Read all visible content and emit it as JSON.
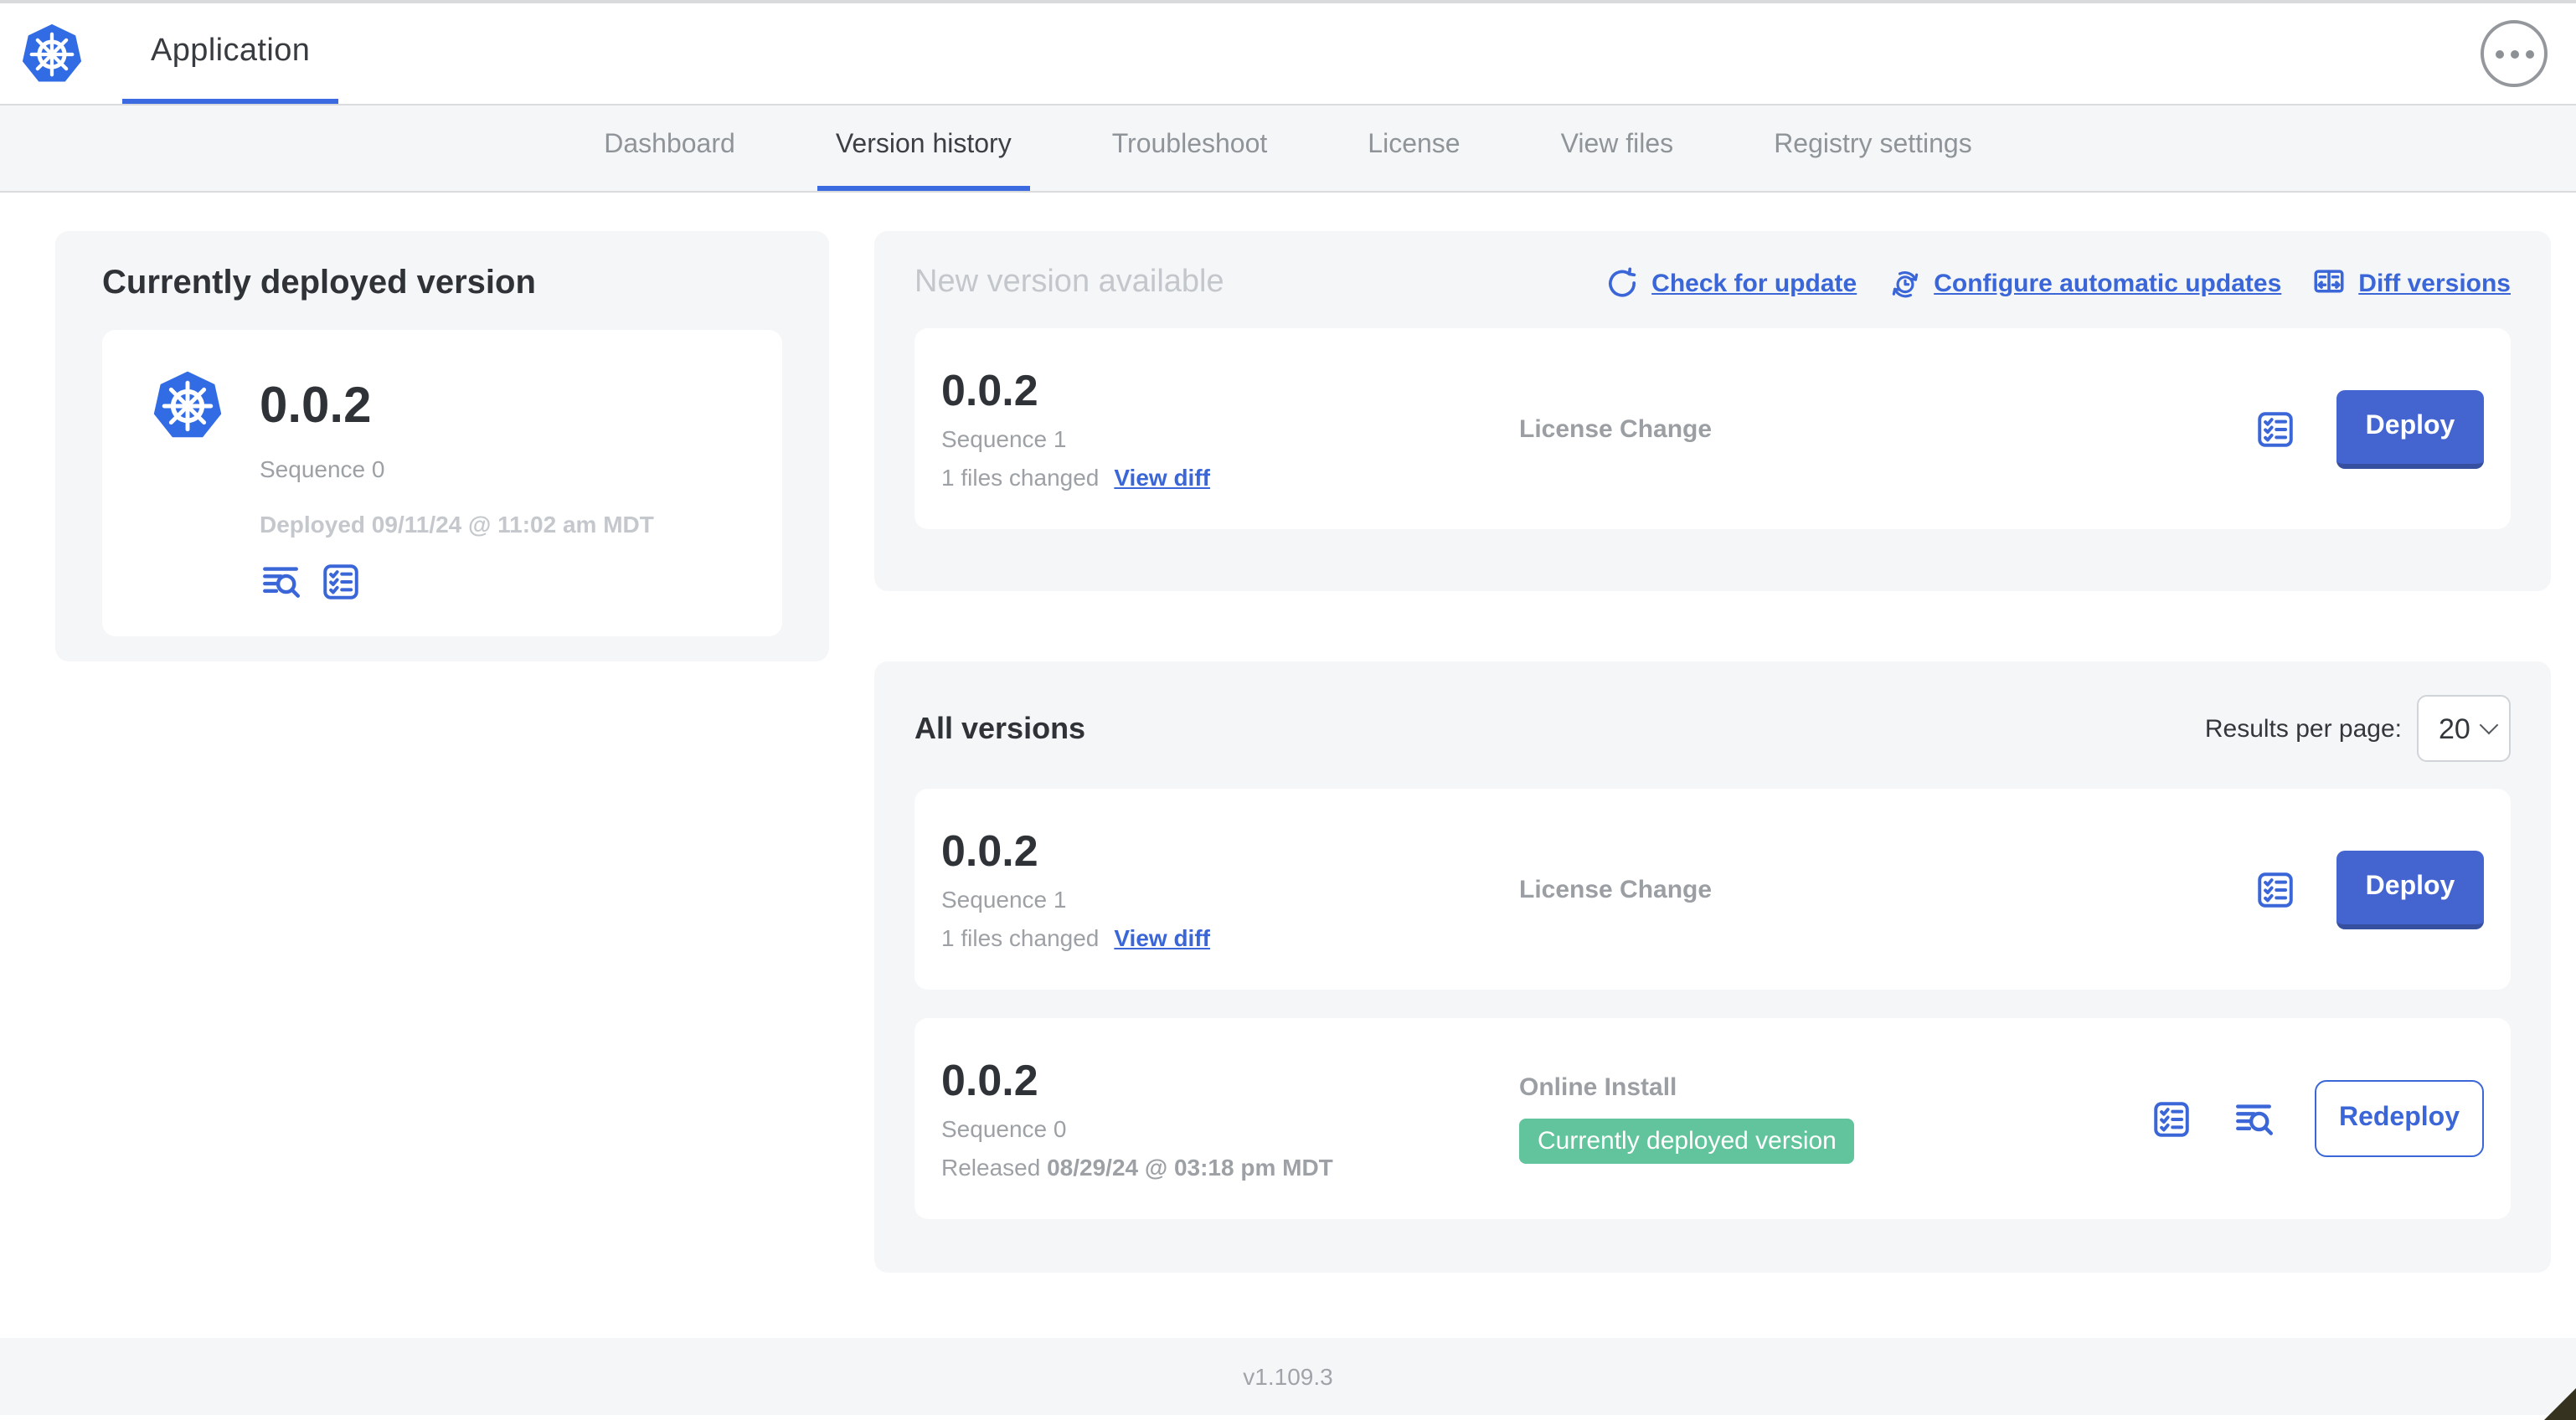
{
  "header": {
    "app_title": "Application"
  },
  "nav": {
    "tabs": [
      {
        "label": "Dashboard"
      },
      {
        "label": "Version history"
      },
      {
        "label": "Troubleshoot"
      },
      {
        "label": "License"
      },
      {
        "label": "View files"
      },
      {
        "label": "Registry settings"
      }
    ],
    "active_tab": "Version history"
  },
  "current_version_panel": {
    "title": "Currently deployed version",
    "version": "0.0.2",
    "sequence": "Sequence 0",
    "deployed": "Deployed 09/11/24 @ 11:02 am MDT"
  },
  "new_version_panel": {
    "title": "New version available",
    "actions": {
      "check_for_update": "Check for update",
      "configure_automatic_updates": "Configure automatic updates",
      "diff_versions": "Diff versions"
    },
    "card": {
      "version": "0.0.2",
      "sequence": "Sequence 1",
      "files_changed": "1 files changed",
      "view_diff": "View diff",
      "source": "License Change",
      "deploy_label": "Deploy"
    }
  },
  "all_versions_panel": {
    "title": "All versions",
    "results_per_page_label": "Results per page:",
    "results_per_page_value": "20",
    "rows": [
      {
        "version": "0.0.2",
        "sequence": "Sequence 1",
        "files_changed": "1 files changed",
        "view_diff": "View diff",
        "source": "License Change",
        "action_label": "Deploy"
      },
      {
        "version": "0.0.2",
        "sequence": "Sequence 0",
        "released_label": "Released",
        "released_value": "08/29/24 @ 03:18 pm MDT",
        "source": "Online Install",
        "badge": "Currently deployed version",
        "action_label": "Redeploy"
      }
    ]
  },
  "footer": {
    "console_version": "v1.109.3"
  },
  "icons": {
    "logo": "kubernetes-logo",
    "menu": "ellipsis-menu",
    "check_update": "refresh-arrow",
    "auto_update": "clock-refresh",
    "diff": "split-diff",
    "logs": "view-logs",
    "preflight": "checklist",
    "select": "chevron-down"
  },
  "colors": {
    "accent_blue": "#3a66d8",
    "k8s_blue": "#326ce5",
    "button_blue": "#4464d0",
    "badge_green": "#62c49c",
    "panel_gray": "#f5f6f8"
  }
}
